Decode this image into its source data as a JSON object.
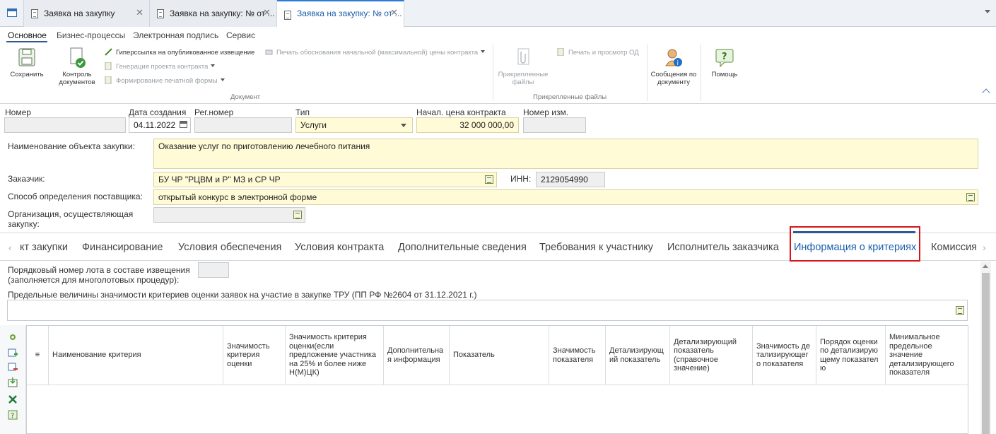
{
  "window_tabs": [
    {
      "label": "Заявка на закупку"
    },
    {
      "label": "Заявка на закупку: № от ..."
    },
    {
      "label": "Заявка на закупку: № от ..."
    }
  ],
  "ribbon_menu": [
    "Основное",
    "Бизнес-процессы",
    "Электронная подпись",
    "Сервис"
  ],
  "ribbon": {
    "save": "Сохранить",
    "control_docs": "Контроль документов",
    "hyperlink": "Гиперссылка на опубликованное извещение",
    "print_justification": "Печать обоснования начальной (максимальной) цены контракта",
    "gen_contract": "Генерация проекта контракта",
    "print_form": "Формирование печатной формы",
    "group_document": "Документ",
    "attached_files": "Прикрепленные файлы",
    "print_view_od": "Печать и просмотр ОД",
    "group_attached": "Прикрепленные файлы",
    "messages": "Сообщения по документу",
    "help": "Помощь"
  },
  "form": {
    "number_label": "Номер",
    "number_value": "",
    "created_label": "Дата создания",
    "created_value": "04.11.2022",
    "regnum_label": "Рег.номер",
    "regnum_value": "",
    "type_label": "Тип",
    "type_value": "Услуги",
    "price_label": "Начал. цена контракта",
    "price_value": "32 000 000,00",
    "change_label": "Номер изм.",
    "change_value": "",
    "object_label": "Наименование объекта закупки:",
    "object_value": "Оказание услуг по приготовлению лечебного питания",
    "customer_label": "Заказчик:",
    "customer_value": "БУ ЧР \"РЦВМ и Р\" МЗ и СР ЧР",
    "inn_label": "ИНН:",
    "inn_value": "2129054990",
    "method_label": "Способ определения поставщика:",
    "method_value": "открытый конкурс в электронной форме",
    "org_label": "Организация, осуществляющая закупку:",
    "org_value": ""
  },
  "section_tabs": [
    "кт закупки",
    "Финансирование",
    "Условия обеспечения",
    "Условия контракта",
    "Дополнительные сведения",
    "Требования к участнику",
    "Исполнитель заказчика",
    "Информация о критериях",
    "Комиссия"
  ],
  "criteria": {
    "lot_label": "Порядковый номер лота в составе извещения (заполняется для многолотовых процедур):",
    "lot_value": "",
    "limits_label": "Предельные величины значимости критериев оценки заявок на участие в закупке ТРУ (ПП РФ №2604 от 31.12.2021 г.)",
    "limits_value": ""
  },
  "grid_columns": [
    "Наименование критерия",
    "Значимость критерия оценки",
    "Значимость критерия оценки(если предложение участника на 25% и более ниже Н(М)ЦК)",
    "Дополнительная информация",
    "Показатель",
    "Значимость показателя",
    "Детализирующий показатель",
    "Детализирующий показатель (справочное значение)",
    "Значимость детализирующего показателя",
    "Порядок оценки по детализирующему показателю",
    "Минимальное предельное значение детализирующего показателя"
  ],
  "icons": [
    "save-icon",
    "control-docs-icon",
    "link-icon",
    "print-icon",
    "attach-icon",
    "messages-icon",
    "help-icon",
    "calendar-icon",
    "dropdown-icon",
    "lookup-icon"
  ]
}
